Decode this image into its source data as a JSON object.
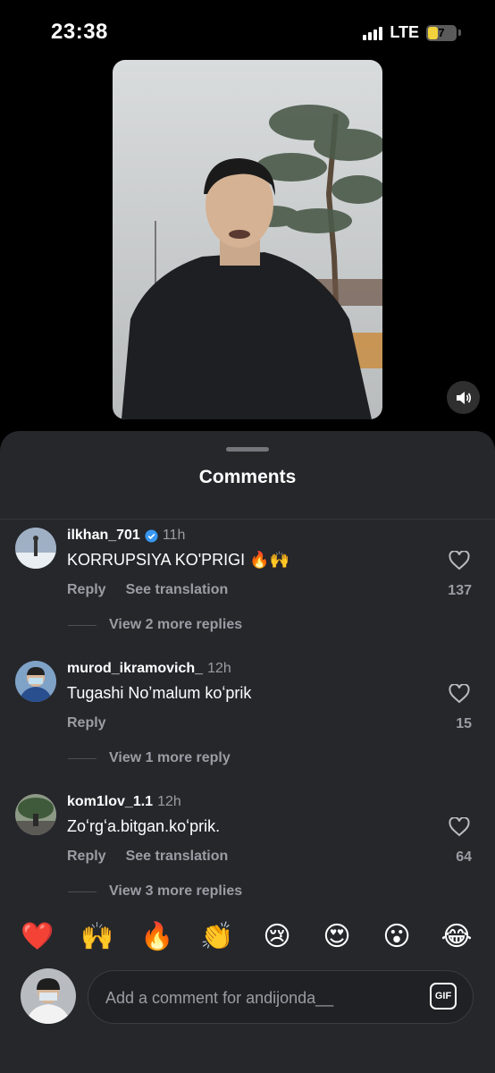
{
  "status_bar": {
    "time": "23:38",
    "network": "LTE",
    "battery": "7"
  },
  "sheet": {
    "title": "Comments"
  },
  "comments": [
    {
      "username": "ilkhan_701",
      "verified": true,
      "time": "11h",
      "text": "KORRUPSIYA KO'PRIGI 🔥🙌",
      "reply_label": "Reply",
      "translate_label": "See translation",
      "likes": "137",
      "view_replies": "View 2 more replies"
    },
    {
      "username": "murod_ikramovich_",
      "verified": false,
      "time": "12h",
      "text": "Tugashi Noʼmalum koʻprik",
      "reply_label": "Reply",
      "translate_label": "",
      "likes": "15",
      "view_replies": "View 1 more reply"
    },
    {
      "username": "kom1lov_1.1",
      "verified": false,
      "time": "12h",
      "text": "Zoʻrgʻa.bitgan.koʻprik.",
      "reply_label": "Reply",
      "translate_label": "See translation",
      "likes": "64",
      "view_replies": "View 3 more replies"
    }
  ],
  "emoji_bar": [
    "❤️",
    "🙌",
    "🔥",
    "👏",
    "😢",
    "😍",
    "😮",
    "😂"
  ],
  "composer": {
    "placeholder": "Add a comment for andijonda__",
    "gif_label": "GIF"
  },
  "colors": {
    "sheet_bg": "#25272b",
    "muted_text": "#9a9da3",
    "verified_blue": "#3897f0"
  }
}
